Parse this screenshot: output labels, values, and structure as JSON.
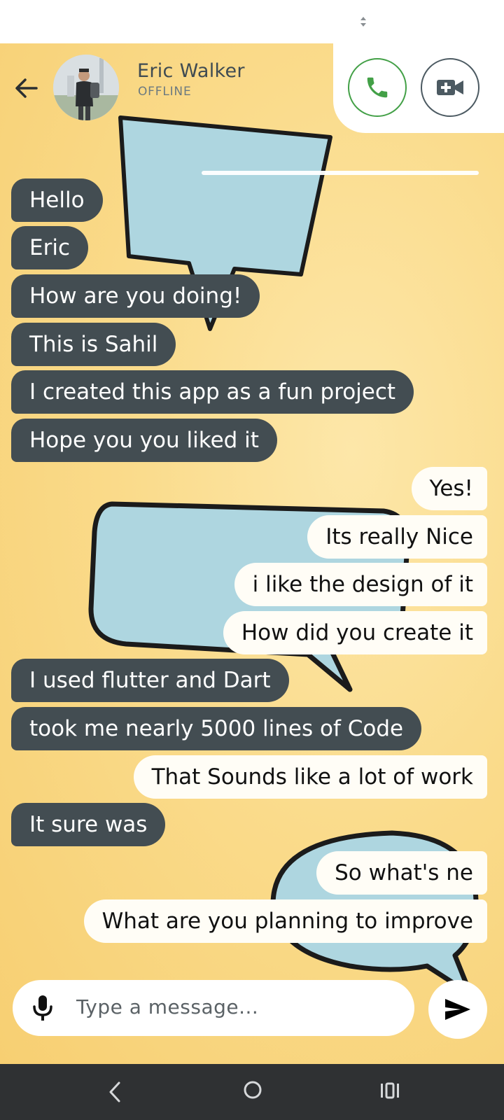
{
  "contact": {
    "name": "Eric Walker",
    "status": "OFFLINE"
  },
  "colors": {
    "incoming_bubble": "#434d52",
    "outgoing_bubble": "#fffdf6",
    "call_accent": "#43a047",
    "video_accent": "#4c5a62",
    "background": "#fadb8b"
  },
  "icons": {
    "back": "arrow-left",
    "call": "phone",
    "video": "video-camera-plus",
    "mic": "microphone",
    "send": "paper-plane"
  },
  "messages": [
    {
      "text": "Hello",
      "from": "contact"
    },
    {
      "text": "Eric",
      "from": "contact"
    },
    {
      "text": "How are you doing!",
      "from": "contact"
    },
    {
      "text": "This is Sahil",
      "from": "contact"
    },
    {
      "text": "I created this app as a fun project",
      "from": "contact"
    },
    {
      "text": "Hope you you liked it",
      "from": "contact"
    },
    {
      "text": "Yes!",
      "from": "me"
    },
    {
      "text": "Its really Nice",
      "from": "me"
    },
    {
      "text": "i like the design of it",
      "from": "me"
    },
    {
      "text": "How did you create it",
      "from": "me"
    },
    {
      "text": "I used flutter and Dart",
      "from": "contact"
    },
    {
      "text": "took me nearly 5000 lines of Code",
      "from": "contact"
    },
    {
      "text": "That Sounds like a lot of work",
      "from": "me"
    },
    {
      "text": "It sure was",
      "from": "contact"
    },
    {
      "text": "So what's ne",
      "from": "me"
    },
    {
      "text": "What are you planning to improve",
      "from": "me"
    }
  ],
  "composer": {
    "placeholder": "Type a message..."
  }
}
